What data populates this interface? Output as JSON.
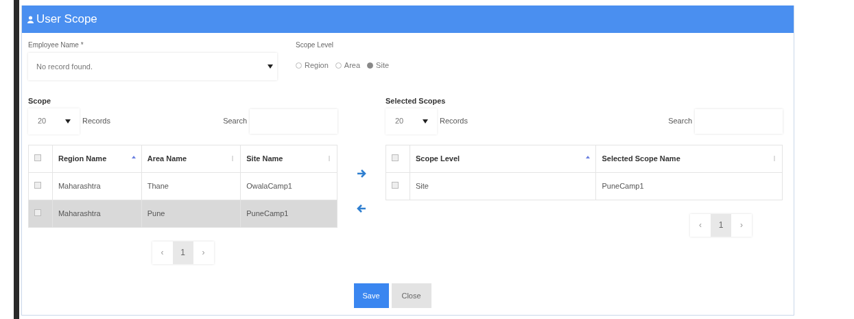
{
  "dialog": {
    "title": "User Scope"
  },
  "employee_name": {
    "label": "Employee Name *",
    "value": "No record found."
  },
  "scope_level": {
    "label": "Scope Level",
    "options": [
      {
        "label": "Region",
        "selected": false
      },
      {
        "label": "Area",
        "selected": false
      },
      {
        "label": "Site",
        "selected": true
      }
    ]
  },
  "scope_table": {
    "title": "Scope",
    "page_size": "20",
    "page_size_label": "Records",
    "search_label": "Search",
    "header_checked": false,
    "columns": [
      {
        "label": "Region Name",
        "sorted": true
      },
      {
        "label": "Area Name",
        "sorted": false
      },
      {
        "label": "Site Name",
        "sorted": false
      }
    ],
    "rows": [
      {
        "checked": false,
        "selected": false,
        "cells": [
          "Maharashtra",
          "Thane",
          "OwalaCamp1"
        ]
      },
      {
        "checked": false,
        "selected": true,
        "cells": [
          "Maharashtra",
          "Pune",
          "PuneCamp1"
        ]
      }
    ],
    "pagination": {
      "prev": "‹",
      "pages": [
        {
          "label": "1",
          "selected": true
        }
      ],
      "next": "›"
    }
  },
  "selected_table": {
    "title": "Selected Scopes",
    "page_size": "20",
    "page_size_label": "Records",
    "search_label": "Search",
    "header_checked": false,
    "columns": [
      {
        "label": "Scope Level",
        "sorted": true
      },
      {
        "label": "Selected Scope Name",
        "sorted": false
      }
    ],
    "rows": [
      {
        "checked": false,
        "selected": false,
        "cells": [
          "Site",
          "PuneCamp1"
        ]
      }
    ],
    "pagination": {
      "prev": "‹",
      "pages": [
        {
          "label": "1",
          "selected": true
        }
      ],
      "next": "›"
    }
  },
  "buttons": [
    {
      "label": "Save",
      "kind": "primary"
    },
    {
      "label": "Close",
      "kind": "secondary"
    }
  ]
}
